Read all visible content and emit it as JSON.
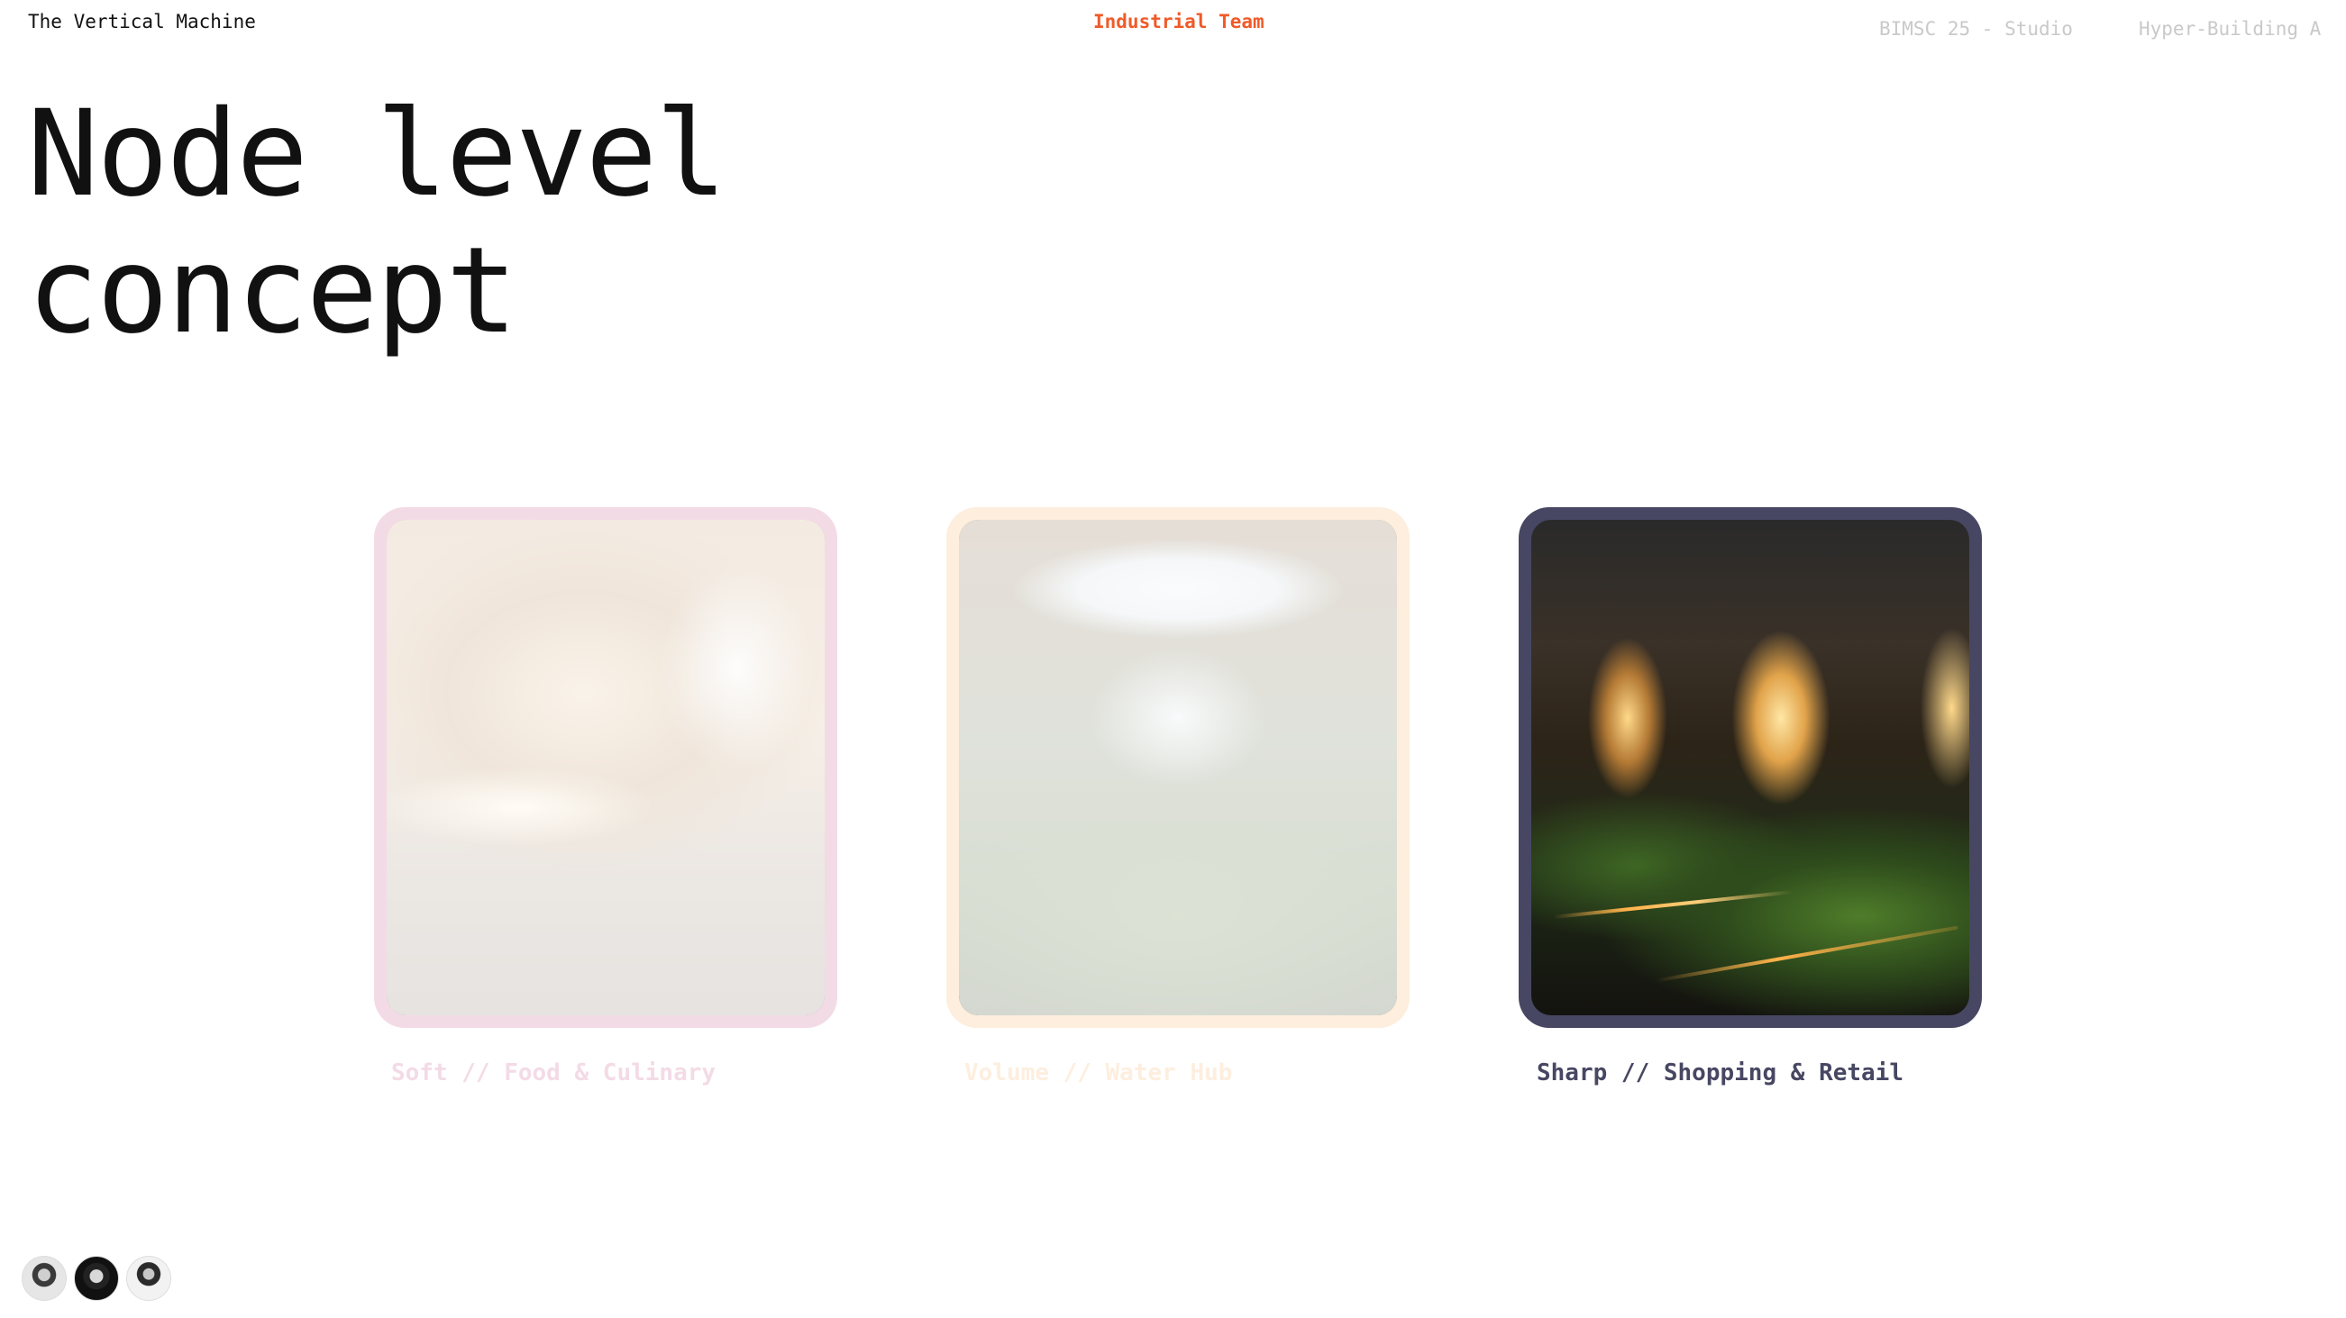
{
  "header": {
    "project": "The Vertical Machine",
    "team": "Industrial Team",
    "course": "BIMSC 25 - Studio",
    "building": "Hyper-Building A"
  },
  "title": {
    "line1": "Node level",
    "line2": "concept"
  },
  "cards": [
    {
      "caption": "Soft // Food & Culinary",
      "frame_color": "#f3dbe6",
      "caption_color": "#f3dbe6",
      "state": "faded"
    },
    {
      "caption": "Volume // Water Hub",
      "frame_color": "#fdeede",
      "caption_color": "#fdeede",
      "state": "faded"
    },
    {
      "caption": "Sharp // Shopping & Retail",
      "frame_color": "#474763",
      "caption_color": "#474763",
      "state": "active"
    }
  ],
  "colors": {
    "accent": "#f05a28",
    "muted_header": "#c9c9c9"
  },
  "avatars": [
    {
      "icon": "person-avatar"
    },
    {
      "icon": "person-avatar"
    },
    {
      "icon": "person-avatar"
    }
  ]
}
